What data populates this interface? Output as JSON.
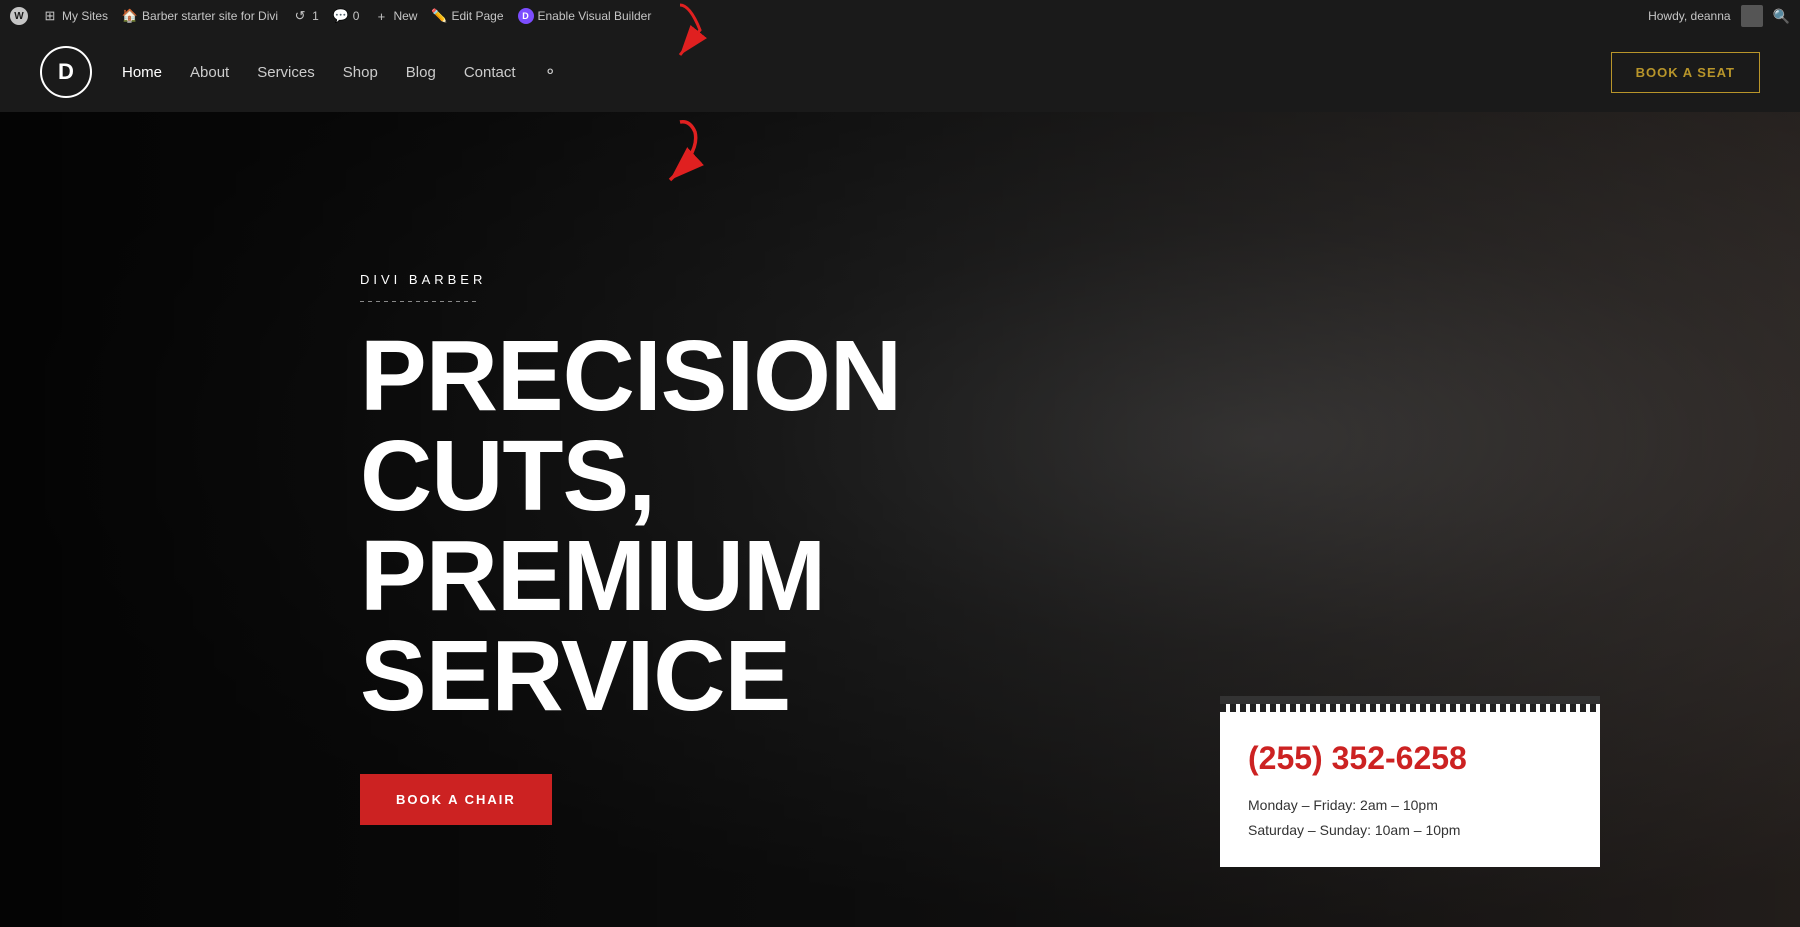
{
  "admin_bar": {
    "my_sites_label": "My Sites",
    "site_name": "Barber starter site for Divi",
    "comments_count": "0",
    "revisions_count": "1",
    "new_label": "New",
    "edit_page_label": "Edit Page",
    "enable_vb_label": "Enable Visual Builder",
    "howdy_label": "Howdy, deanna",
    "search_icon": "🔍"
  },
  "header": {
    "logo_letter": "D",
    "nav_items": [
      {
        "label": "Home",
        "active": true
      },
      {
        "label": "About",
        "active": false
      },
      {
        "label": "Services",
        "active": false
      },
      {
        "label": "Shop",
        "active": false
      },
      {
        "label": "Blog",
        "active": false
      },
      {
        "label": "Contact",
        "active": false
      }
    ],
    "book_seat_label": "BOOK A SEAT"
  },
  "hero": {
    "site_label": "DIVI BARBER",
    "title_line1": "PRECISION CUTS,",
    "title_line2": "PREMIUM SERVICE",
    "cta_label": "BOOK A CHAIR"
  },
  "info_card": {
    "phone": "(255) 352-6258",
    "hours_line1": "Monday – Friday: 2am – 10pm",
    "hours_line2": "Saturday – Sunday: 10am – 10pm"
  },
  "colors": {
    "admin_bg": "#1a1a1a",
    "accent_red": "#cc2222",
    "accent_gold": "#b8952a",
    "divi_purple": "#7c4dff"
  }
}
